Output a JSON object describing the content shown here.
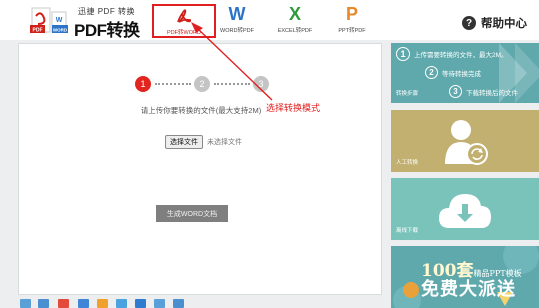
{
  "header": {
    "logo_small": "迅捷 PDF 转换",
    "logo_big": "PDF转换器",
    "tabs": [
      {
        "label": "PDF转WORD",
        "icon": "pdf-icon",
        "color": "#d0201a",
        "active": true
      },
      {
        "label": "WORD转PDF",
        "icon": "word-icon",
        "color": "#2b74c7",
        "active": false
      },
      {
        "label": "EXCEL转PDF",
        "icon": "excel-icon",
        "color": "#2f9a3a",
        "active": false
      },
      {
        "label": "PPT转PDF",
        "icon": "ppt-icon",
        "color": "#e6892a",
        "active": false
      }
    ],
    "help_label": "帮助中心"
  },
  "main": {
    "steps": [
      "1",
      "2",
      "3"
    ],
    "hint": "请上传你要转换的文件(最大支持2M)",
    "file_button": "选择文件",
    "file_none": "未选择文件",
    "generate_button": "生成WORD文档"
  },
  "annotation": {
    "label": "选择转换模式",
    "color": "#e02020"
  },
  "sidebar": {
    "steps_title": "转换步骤",
    "steps": [
      {
        "num": "1",
        "text": "上传需要转换的文件，最大2M。"
      },
      {
        "num": "2",
        "text": "等待转换完成"
      },
      {
        "num": "3",
        "text": "下载转换后的文件"
      }
    ],
    "manual_label": "人工转换",
    "download_label": "离线下载",
    "ad_number": "100套",
    "ad_small": "精品PPT模板",
    "ad_line2": "免费大派送",
    "colors": {
      "teal": "#5fa9ad",
      "gold": "#c2b070",
      "mint": "#79c3ba"
    }
  }
}
